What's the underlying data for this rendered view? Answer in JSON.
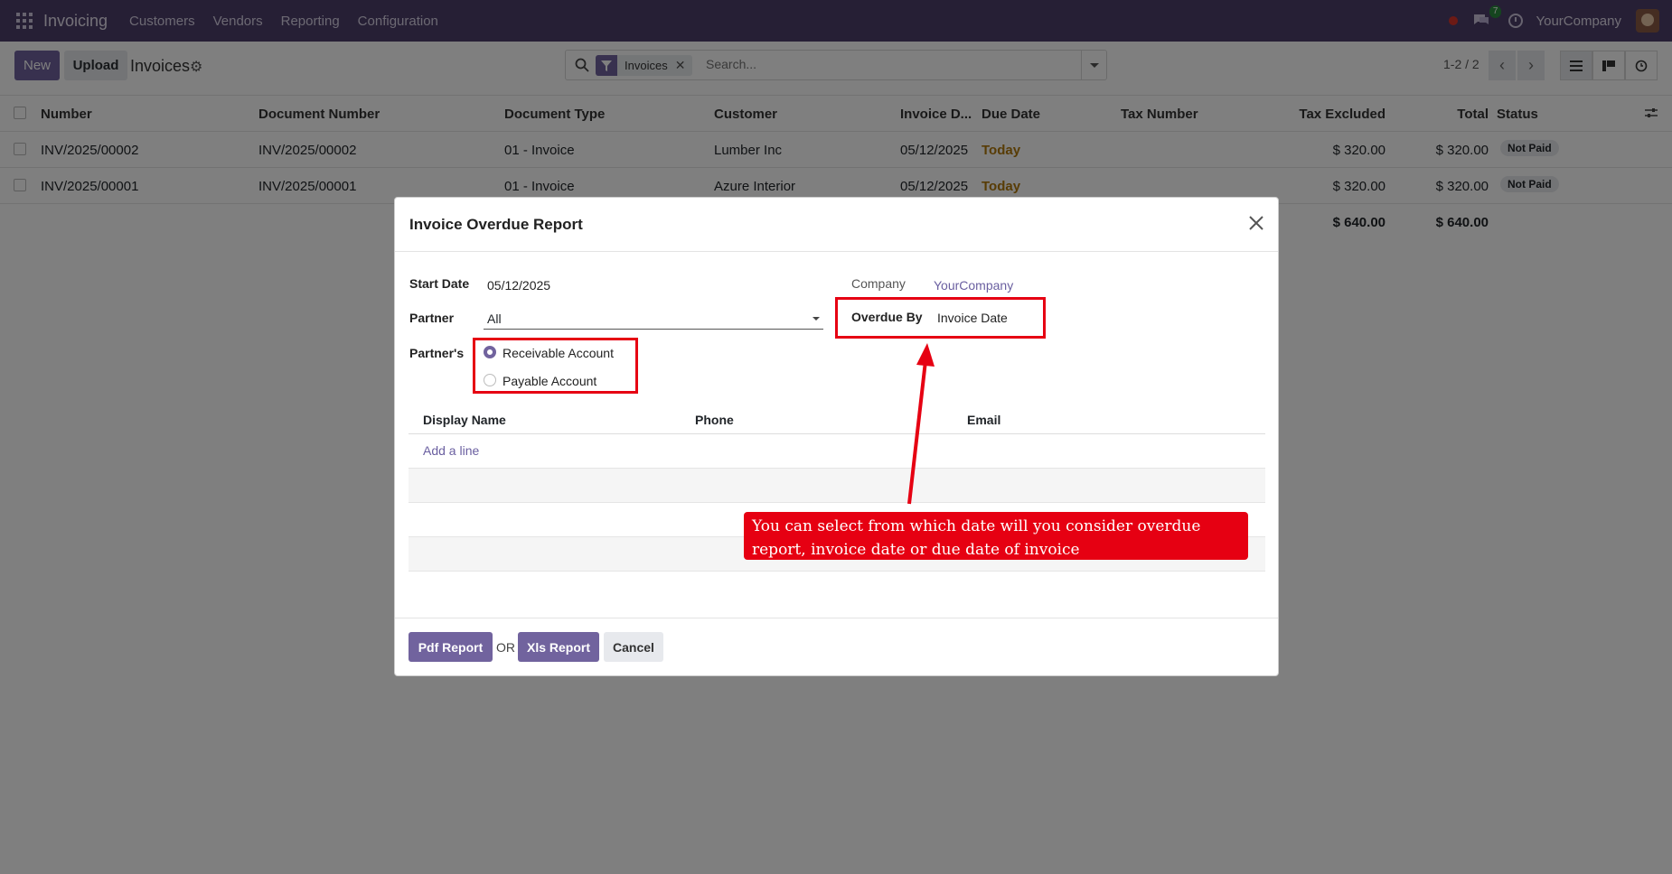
{
  "navbar": {
    "app_name": "Invoicing",
    "menu": [
      "Customers",
      "Vendors",
      "Reporting",
      "Configuration"
    ],
    "chat_count": "7",
    "company": "YourCompany"
  },
  "control": {
    "new_label": "New",
    "upload_label": "Upload",
    "title": "Invoices",
    "facet_label": "Invoices",
    "search_placeholder": "Search...",
    "pager": "1-2 / 2"
  },
  "list": {
    "columns": [
      "Number",
      "Document Number",
      "Document Type",
      "Customer",
      "Invoice D...",
      "Due Date",
      "Tax Number",
      "Tax Excluded",
      "Total",
      "Status"
    ],
    "rows": [
      {
        "number": "INV/2025/00002",
        "doc_number": "INV/2025/00002",
        "doc_type": "01 - Invoice",
        "customer": "Lumber Inc",
        "invoice_date": "05/12/2025",
        "due_date": "Today",
        "tax_number": "",
        "tax_excluded": "$ 320.00",
        "total": "$ 320.00",
        "status": "Not Paid"
      },
      {
        "number": "INV/2025/00001",
        "doc_number": "INV/2025/00001",
        "doc_type": "01 - Invoice",
        "customer": "Azure Interior",
        "invoice_date": "05/12/2025",
        "due_date": "Today",
        "tax_number": "",
        "tax_excluded": "$ 320.00",
        "total": "$ 320.00",
        "status": "Not Paid"
      }
    ],
    "sum_tax_excluded": "$ 640.00",
    "sum_total": "$ 640.00"
  },
  "modal": {
    "title": "Invoice Overdue Report",
    "start_date_label": "Start Date",
    "start_date_value": "05/12/2025",
    "partner_label": "Partner",
    "partner_value": "All",
    "partners_label": "Partner's",
    "radio_options": [
      "Receivable Account",
      "Payable Account"
    ],
    "company_label": "Company",
    "company_value": "YourCompany",
    "overdue_by_label": "Overdue By",
    "overdue_by_value": "Invoice Date",
    "table_columns": [
      "Display Name",
      "Phone",
      "Email"
    ],
    "add_line": "Add a line",
    "pdf_label": "Pdf Report",
    "or_label": "OR",
    "xls_label": "Xls Report",
    "cancel_label": "Cancel"
  },
  "callout": {
    "text": "You can select from which date will you consider overdue report, invoice date or due date of invoice"
  },
  "colors": {
    "navbar": "#4d3f6b",
    "primary": "#71639e",
    "annotation": "#e60012",
    "today": "#b0780a"
  }
}
